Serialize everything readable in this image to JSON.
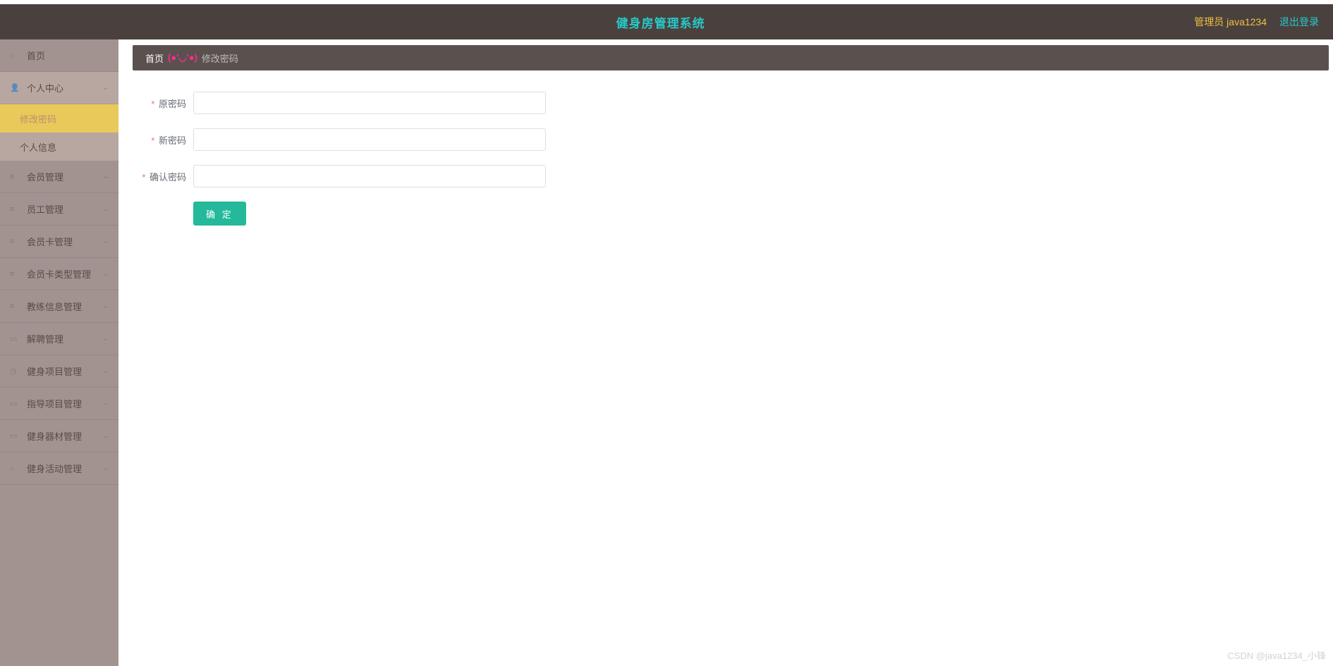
{
  "header": {
    "title": "健身房管理系统",
    "user_label": "管理员 java1234",
    "logout_label": "退出登录"
  },
  "sidebar": {
    "items": [
      {
        "icon": "home-icon",
        "glyph": "⌂",
        "label": "首页",
        "expandable": false
      },
      {
        "icon": "user-icon",
        "glyph": "👤",
        "label": "个人中心",
        "expandable": true,
        "open": true,
        "submenu": [
          {
            "label": "修改密码",
            "active": true
          },
          {
            "label": "个人信息",
            "active": false
          }
        ]
      },
      {
        "icon": "chart-icon",
        "glyph": "≡",
        "label": "会员管理",
        "expandable": true
      },
      {
        "icon": "list-icon",
        "glyph": "≡",
        "label": "员工管理",
        "expandable": true
      },
      {
        "icon": "bar-icon",
        "glyph": "≡",
        "label": "会员卡管理",
        "expandable": true
      },
      {
        "icon": "list-icon",
        "glyph": "≡",
        "label": "会员卡类型管理",
        "expandable": true
      },
      {
        "icon": "list-icon",
        "glyph": "≡",
        "label": "教练信息管理",
        "expandable": true
      },
      {
        "icon": "case-icon",
        "glyph": "▭",
        "label": "解聘管理",
        "expandable": true
      },
      {
        "icon": "clock-icon",
        "glyph": "◷",
        "label": "健身项目管理",
        "expandable": true
      },
      {
        "icon": "doc-icon",
        "glyph": "▭",
        "label": "指导项目管理",
        "expandable": true
      },
      {
        "icon": "box-icon",
        "glyph": "▭",
        "label": "健身器材管理",
        "expandable": true
      },
      {
        "icon": "circle-icon",
        "glyph": "○",
        "label": "健身活动管理",
        "expandable": true
      }
    ]
  },
  "breadcrumb": {
    "home": "首页",
    "sep": "(●'◡'●)",
    "current": "修改密码"
  },
  "form": {
    "required_mark": "*",
    "fields": [
      {
        "name": "old-password",
        "label": "原密码",
        "value": ""
      },
      {
        "name": "new-password",
        "label": "新密码",
        "value": ""
      },
      {
        "name": "confirm-password",
        "label": "确认密码",
        "value": ""
      }
    ],
    "submit_label": "确 定"
  },
  "watermark": "CSDN @java1234_小锋"
}
